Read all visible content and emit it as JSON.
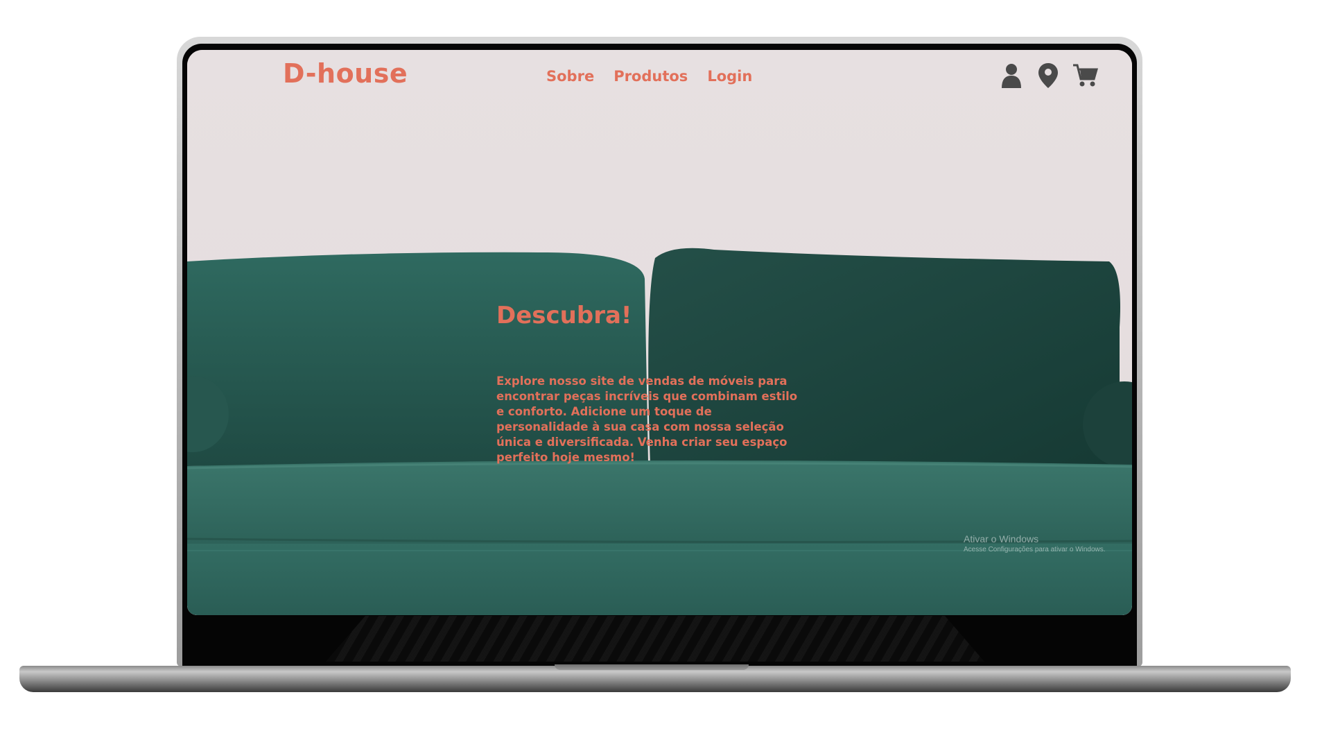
{
  "header": {
    "brand": "D-house",
    "nav": [
      {
        "label": "Sobre"
      },
      {
        "label": "Produtos"
      },
      {
        "label": "Login"
      }
    ],
    "icons": [
      "user-icon",
      "location-pin-icon",
      "cart-icon"
    ]
  },
  "hero": {
    "title": "Descubra!",
    "text": "Explore nosso site de vendas de móveis para encontrar peças incríveis que combinam estilo e conforto. Adicione um toque de personalidade à sua casa com nossa seleção única e diversificada. Venha criar seu espaço perfeito hoje mesmo!"
  },
  "watermark": {
    "title": "Ativar o Windows",
    "subtitle": "Acesse Configurações para ativar o Windows."
  },
  "colors": {
    "accent": "#e2705a",
    "wall": "#e6dfe0",
    "sofa": "#2a5a52",
    "icon": "#4a4a4a"
  }
}
